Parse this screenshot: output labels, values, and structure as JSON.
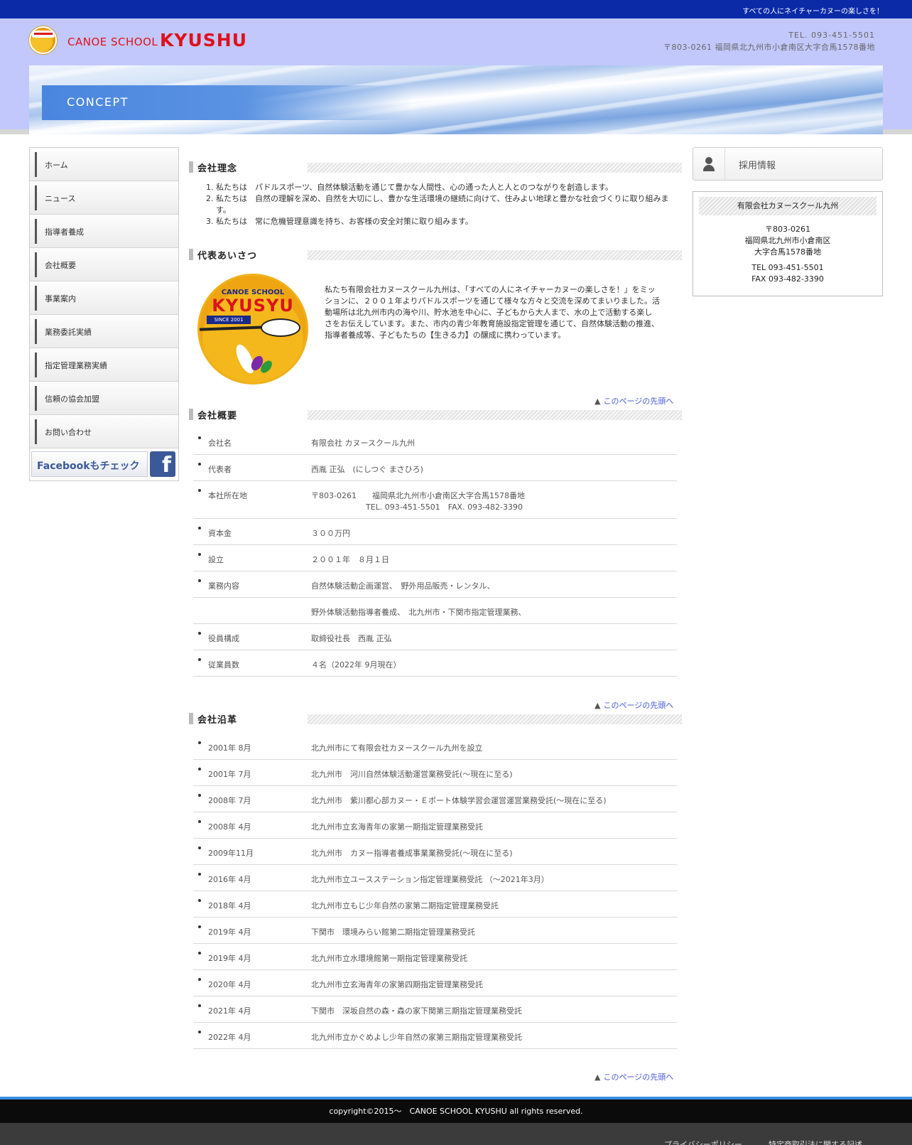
{
  "topbar": {
    "tagline": "すべての人にネイチャーカヌーの楽しさを！"
  },
  "header": {
    "logo_small": "CANOE SCHOOL",
    "logo_big": "KYUSHU",
    "tel": "TEL. 093-451-5501",
    "address": "〒803-0261 福岡県北九州市小倉南区大字合馬1578番地"
  },
  "banner": {
    "title": "CONCEPT"
  },
  "nav": {
    "items": [
      {
        "label": "ホーム"
      },
      {
        "label": "ニュース"
      },
      {
        "label": "指導者養成"
      },
      {
        "label": "会社概要"
      },
      {
        "label": "事業案内"
      },
      {
        "label": "業務委託実績"
      },
      {
        "label": "指定管理業務実績"
      },
      {
        "label": "信頼の協会加盟"
      },
      {
        "label": "お問い合わせ"
      }
    ],
    "facebook_label": "Facebookもチェック",
    "facebook_icon": "f"
  },
  "philosophy": {
    "heading": "会社理念",
    "items": [
      "私たちは　パドルスポーツ、自然体験活動を通じて豊かな人間性、心の通った人と人とのつながりを創造します。",
      "私たちは　自然の理解を深め、自然を大切にし、豊かな生活環境の継続に向けて、住みよい地球と豊かな社会づくりに取り組みます。",
      "私たちは　常に危機管理意識を持ち、お客様の安全対策に取り組みます。"
    ]
  },
  "greeting": {
    "heading": "代表あいさつ",
    "logo_top": "CANOE SCHOOL",
    "logo_main": "KYUSYU",
    "logo_since": "SINCE 2001",
    "text": "私たち有限会社カヌースクール九州は、「すべての人にネイチャーカヌーの楽しさを！」をミッションに、２００１年よりパドルスポーツを通じて様々な方々と交流を深めてまいりました。活動場所は北九州市内の海や川、貯水池を中心に、子どもから大人まで、水の上で活動する楽しさをお伝えしています。また、市内の青少年教育施設指定管理を通じて、自然体験活動の推進、指導者養成等、子どもたちの【生きる力】の醸成に携わっています。"
  },
  "to_top": {
    "label": "このページの先頭へ",
    "arrow": "▲"
  },
  "overview": {
    "heading": "会社概要",
    "rows": [
      {
        "label": "会社名",
        "value": "有限会社 カヌースクール九州"
      },
      {
        "label": "代表者",
        "value": "西胤 正弘　(にしつぐ まさひろ)"
      },
      {
        "label": "本社所在地",
        "value": "〒803-0261　　福岡県北九州市小倉南区大字合馬1578番地",
        "value2": "TEL. 093-451-5501　FAX. 093-482-3390"
      },
      {
        "label": "資本金",
        "value": "３００万円"
      },
      {
        "label": "設立",
        "value": "２００１年　８月１日"
      },
      {
        "label": "業務内容",
        "value": "自然体験活動企画運営、　野外用品販売・レンタル、"
      },
      {
        "label": "",
        "value": "野外体験活動指導者養成、　北九州市・下関市指定管理業務、"
      },
      {
        "label": "役員構成",
        "value": "取締役社長　西胤 正弘"
      },
      {
        "label": "従業員数",
        "value": "４名（2022年 9月現在）"
      }
    ]
  },
  "history": {
    "heading": "会社沿革",
    "rows": [
      {
        "label": "2001年 8月",
        "value": "北九州市にて有限会社カヌースクール九州を設立"
      },
      {
        "label": "2001年 7月",
        "value": "北九州市　河川自然体験活動運営業務受託(〜現在に至る)"
      },
      {
        "label": "2008年 7月",
        "value": "北九州市　紫川都心部カヌー・Ｅボート体験学習会運営運営業務受託(〜現在に至る)"
      },
      {
        "label": "2008年 4月",
        "value": "北九州市立玄海青年の家第一期指定管理業務受託"
      },
      {
        "label": "2009年11月",
        "value": "北九州市　カヌー指導者養成事業業務受託(〜現在に至る)"
      },
      {
        "label": "2016年 4月",
        "value": "北九州市立ユースステーション指定管理業務受託 （〜2021年3月）"
      },
      {
        "label": "2018年 4月",
        "value": "北九州市立もじ少年自然の家第二期指定管理業務受託"
      },
      {
        "label": "2019年 4月",
        "value": "下関市　環境みらい館第二期指定管理業務受託"
      },
      {
        "label": "2019年 4月",
        "value": "北九州市立水環境館第一期指定管理業務受託"
      },
      {
        "label": "2020年 4月",
        "value": "北九州市立玄海青年の家第四期指定管理業務受託"
      },
      {
        "label": "2021年 4月",
        "value": "下関市　深坂自然の森・森の家下関第三期指定管理業務受託"
      },
      {
        "label": "2022年 4月",
        "value": "北九州市立かぐめよし少年自然の家第三期指定管理業務受託"
      }
    ]
  },
  "sidebar": {
    "recruit_label": "採用情報",
    "company_name": "有限会社カヌースクール九州",
    "lines": [
      "〒803-0261",
      "福岡県北九州市小倉南区",
      "大字合馬1578番地",
      "TEL 093-451-5501",
      "FAX 093-482-3390"
    ]
  },
  "footer": {
    "copyright": "copyright©2015〜　CANOE SCHOOL KYUSHU all rights reserved.",
    "links": [
      "プライバシーポリシー",
      "特定商取引法に関する記述"
    ]
  }
}
